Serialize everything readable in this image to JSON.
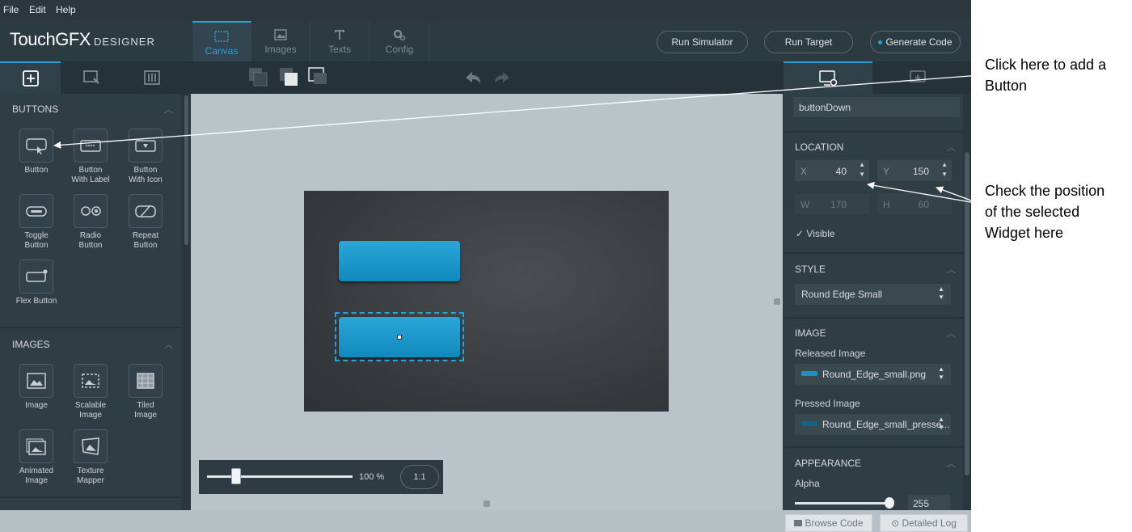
{
  "menu": {
    "file": "File",
    "edit": "Edit",
    "help": "Help"
  },
  "logo": {
    "main": "TouchGFX",
    "sub": "DESIGNER"
  },
  "tabs": {
    "canvas": "Canvas",
    "images": "Images",
    "texts": "Texts",
    "config": "Config"
  },
  "actions": {
    "run_simulator": "Run Simulator",
    "run_target": "Run Target",
    "generate_code": "Generate Code"
  },
  "left": {
    "buttons_title": "BUTTONS",
    "buttons": [
      {
        "l1": "Button",
        "l2": ""
      },
      {
        "l1": "Button",
        "l2": "With Label"
      },
      {
        "l1": "Button",
        "l2": "With Icon"
      },
      {
        "l1": "Toggle",
        "l2": "Button"
      },
      {
        "l1": "Radio",
        "l2": "Button"
      },
      {
        "l1": "Repeat",
        "l2": "Button"
      },
      {
        "l1": "Flex Button",
        "l2": ""
      }
    ],
    "images_title": "IMAGES",
    "images": [
      {
        "l1": "Image",
        "l2": ""
      },
      {
        "l1": "Scalable",
        "l2": "Image"
      },
      {
        "l1": "Tiled",
        "l2": "Image"
      },
      {
        "l1": "Animated",
        "l2": "Image"
      },
      {
        "l1": "Texture",
        "l2": "Mapper"
      }
    ]
  },
  "zoom": {
    "percent": "100 %",
    "ratio": "1:1",
    "level": 0.2
  },
  "status": {
    "browse": "Browse Code",
    "log": "Detailed Log"
  },
  "props": {
    "name": "buttonDown",
    "location_title": "LOCATION",
    "x_label": "X",
    "x": "40",
    "y_label": "Y",
    "y": "150",
    "w_label": "W",
    "w": "170",
    "h_label": "H",
    "h": "60",
    "visible": "Visible",
    "style_title": "STYLE",
    "style": "Round Edge Small",
    "image_title": "IMAGE",
    "released_label": "Released Image",
    "released": "Round_Edge_small.png",
    "pressed_label": "Pressed Image",
    "pressed": "Round_Edge_small_presse...",
    "appearance_title": "APPEARANCE",
    "alpha_label": "Alpha",
    "alpha": "255"
  },
  "annotations": {
    "a1_l1": "Click here to add a",
    "a1_l2": "Button",
    "a2_l1": "Check the position",
    "a2_l2": "of the selected",
    "a2_l3": "Widget here"
  }
}
